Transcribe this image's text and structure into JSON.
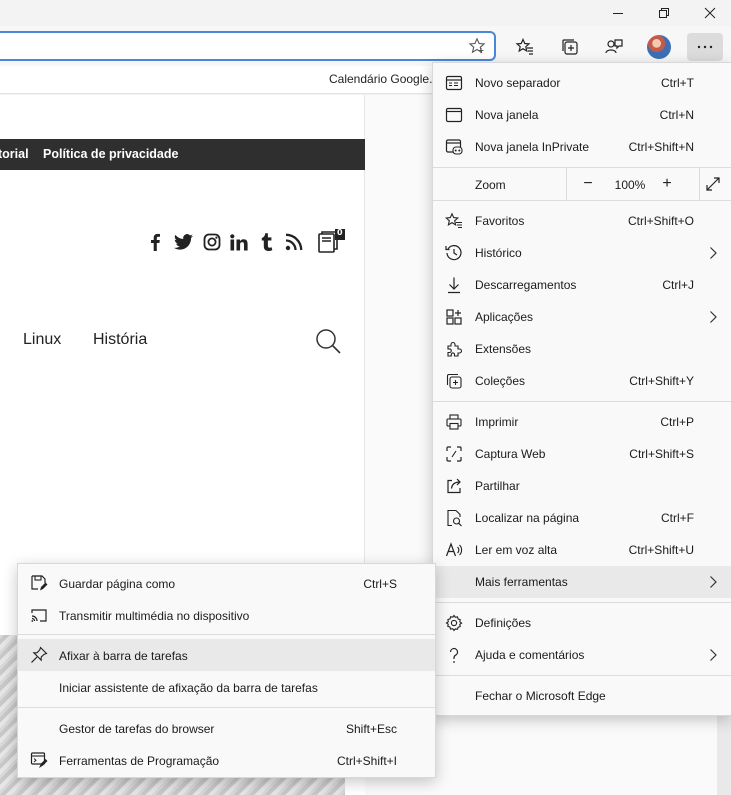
{
  "favorites_bar": {
    "item": "Calendário Google..."
  },
  "site": {
    "top_links": [
      "torial",
      "Política de privacidade"
    ],
    "nav": [
      "Linux",
      "História"
    ],
    "cart_badge": "0"
  },
  "menu": {
    "items": [
      {
        "label": "Novo separador",
        "shortcut": "Ctrl+T",
        "icon": "new-tab-icon"
      },
      {
        "label": "Nova janela",
        "shortcut": "Ctrl+N",
        "icon": "new-window-icon"
      },
      {
        "label": "Nova janela InPrivate",
        "shortcut": "Ctrl+Shift+N",
        "icon": "inprivate-icon"
      },
      {
        "label": "Favoritos",
        "shortcut": "Ctrl+Shift+O",
        "icon": "favorites-icon"
      },
      {
        "label": "Histórico",
        "shortcut": "",
        "icon": "history-icon"
      },
      {
        "label": "Descarregamentos",
        "shortcut": "Ctrl+J",
        "icon": "downloads-icon"
      },
      {
        "label": "Aplicações",
        "shortcut": "",
        "icon": "apps-icon"
      },
      {
        "label": "Extensões",
        "shortcut": "",
        "icon": "extensions-icon"
      },
      {
        "label": "Coleções",
        "shortcut": "Ctrl+Shift+Y",
        "icon": "collections-icon"
      },
      {
        "label": "Imprimir",
        "shortcut": "Ctrl+P",
        "icon": "print-icon"
      },
      {
        "label": "Captura Web",
        "shortcut": "Ctrl+Shift+S",
        "icon": "web-capture-icon"
      },
      {
        "label": "Partilhar",
        "shortcut": "",
        "icon": "share-icon"
      },
      {
        "label": "Localizar na página",
        "shortcut": "Ctrl+F",
        "icon": "find-icon"
      },
      {
        "label": "Ler em voz alta",
        "shortcut": "Ctrl+Shift+U",
        "icon": "read-aloud-icon"
      },
      {
        "label": "Mais ferramentas",
        "shortcut": "",
        "icon": ""
      },
      {
        "label": "Definições",
        "shortcut": "",
        "icon": "settings-icon"
      },
      {
        "label": "Ajuda e comentários",
        "shortcut": "",
        "icon": "help-icon"
      },
      {
        "label": "Fechar o Microsoft Edge",
        "shortcut": "",
        "icon": ""
      }
    ],
    "zoom": {
      "label": "Zoom",
      "value": "100%",
      "minus": "−",
      "plus": "+"
    }
  },
  "submenu": {
    "items": [
      {
        "label": "Guardar página como",
        "shortcut": "Ctrl+S",
        "icon": "save-page-icon"
      },
      {
        "label": "Transmitir multimédia no dispositivo",
        "shortcut": "",
        "icon": "cast-icon"
      },
      {
        "label": "Afixar à barra de tarefas",
        "shortcut": "",
        "icon": "pin-icon"
      },
      {
        "label": "Iniciar assistente de afixação da barra de tarefas",
        "shortcut": "",
        "icon": ""
      },
      {
        "label": "Gestor de tarefas do browser",
        "shortcut": "Shift+Esc",
        "icon": ""
      },
      {
        "label": "Ferramentas de Programação",
        "shortcut": "Ctrl+Shift+I",
        "icon": "devtools-icon"
      }
    ]
  }
}
